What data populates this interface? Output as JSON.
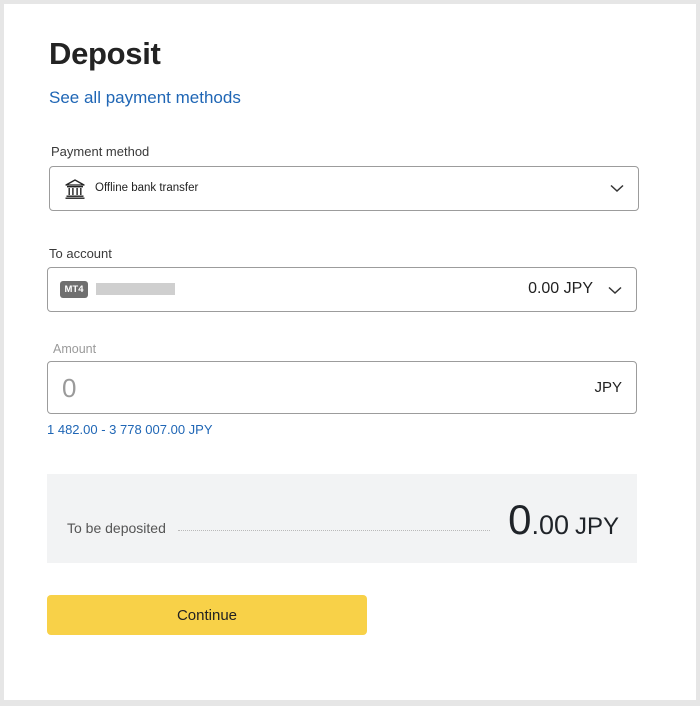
{
  "page": {
    "title": "Deposit",
    "link": "See all payment methods"
  },
  "payment_method": {
    "label": "Payment method",
    "value": "Offline bank transfer",
    "icon": "bank-icon"
  },
  "to_account": {
    "label": "To account",
    "badge": "MT4",
    "balance": "0.00 JPY",
    "icon": "chevron-down-icon"
  },
  "amount": {
    "label": "Amount",
    "placeholder": "0",
    "currency": "JPY",
    "range": "1 482.00 - 3 778 007.00 JPY"
  },
  "summary": {
    "label": "To be deposited",
    "value_int": "0",
    "value_dec": ".00",
    "currency": "JPY"
  },
  "actions": {
    "continue_label": "Continue"
  },
  "colors": {
    "accent_link": "#1f66b5",
    "button": "#f8d148",
    "summary_bg": "#f2f3f4"
  }
}
